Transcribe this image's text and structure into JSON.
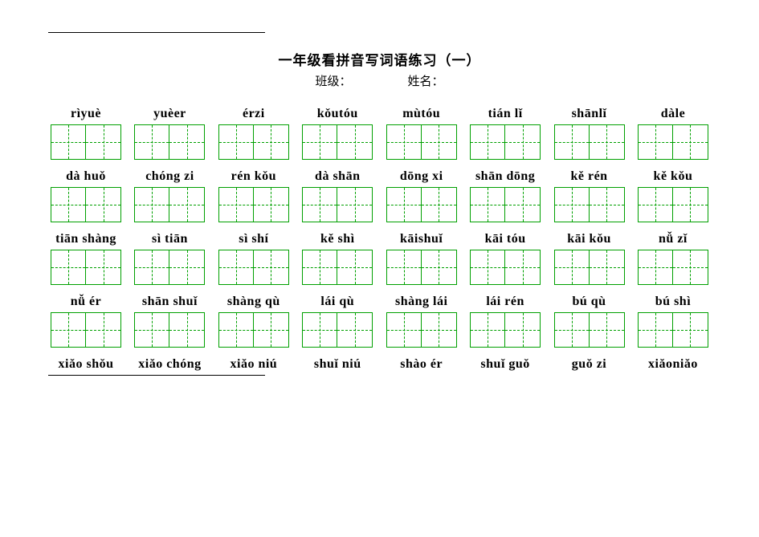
{
  "header": {
    "title": "一年级看拼音写词语练习（一）",
    "class_label": "班级：",
    "name_label": "姓名："
  },
  "rows": [
    {
      "with_boxes": true,
      "items": [
        "rìyuè",
        "yuèer",
        "érzi",
        "kǒutóu",
        "mùtóu",
        "tián lǐ",
        "shānlǐ",
        "dàle"
      ]
    },
    {
      "with_boxes": true,
      "items": [
        "dà huǒ",
        "chóng zi",
        "rén kǒu",
        "dà shān",
        "dōng xi",
        "shān dōng",
        "kě rén",
        "kě kǒu"
      ]
    },
    {
      "with_boxes": true,
      "items": [
        "tiān shàng",
        "sì tiān",
        "sì shí",
        "kě shì",
        "kāishuǐ",
        "kāi tóu",
        "kāi kǒu",
        "nǚ zǐ"
      ]
    },
    {
      "with_boxes": true,
      "items": [
        "nǚ ér",
        "shān shuǐ",
        "shàng qù",
        "lái qù",
        "shàng lái",
        "lái rén",
        "bú qù",
        "bú shì"
      ]
    },
    {
      "with_boxes": false,
      "items": [
        "xiǎo shǒu",
        "xiǎo chóng",
        "xiǎo niú",
        "shuǐ niú",
        "shào ér",
        "shuǐ guǒ",
        "guǒ zi",
        "xiǎoniǎo"
      ]
    }
  ]
}
